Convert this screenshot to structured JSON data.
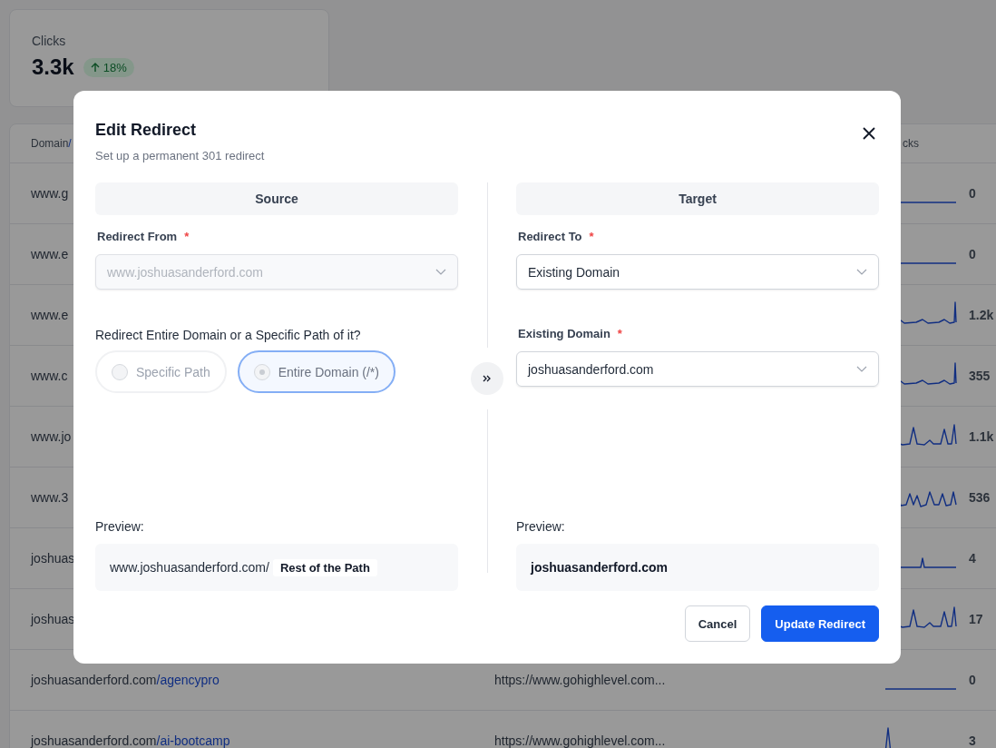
{
  "stats_card": {
    "label": "Clicks",
    "value": "3.3k",
    "change": {
      "text": "18%",
      "kind": "up"
    }
  },
  "table": {
    "columns": [
      {
        "label": "Domain",
        "accent": "/"
      },
      {
        "label": "cks"
      }
    ],
    "rows": [
      {
        "domain": "www.g",
        "clicks": "0",
        "sparkline": {
          "kind": "flat"
        }
      },
      {
        "domain": "www.e",
        "clicks": "0",
        "sparkline": {
          "kind": "flat"
        }
      },
      {
        "domain": "www.e",
        "clicks": "1.2k",
        "sparkline": {
          "kind": "tail"
        }
      },
      {
        "domain": "www.c",
        "clicks": "355",
        "sparkline": {
          "kind": "tail"
        }
      },
      {
        "domain": "www.jo",
        "clicks": "1.1k",
        "sparkline": {
          "kind": "peaks"
        }
      },
      {
        "domain": "www.3",
        "clicks": "536",
        "sparkline": {
          "kind": "waves"
        }
      },
      {
        "domain": "joshuas",
        "clicks": "4",
        "sparkline": {
          "kind": "spike"
        }
      },
      {
        "domain": "joshuas",
        "clicks": "17",
        "sparkline": {
          "kind": "peaks"
        }
      },
      {
        "domain": "joshuasanderford.com",
        "path": "/agencypro",
        "target": "https://www.gohighlevel.com...",
        "clicks": "0",
        "sparkline": {
          "kind": "flat"
        }
      },
      {
        "domain": "joshuasanderford.com",
        "path": "/ai-bootcamp",
        "target": "https://www.gohighlevel.com...",
        "clicks": "3",
        "sparkline": {
          "kind": "first"
        }
      }
    ]
  },
  "dialog": {
    "title": "Edit Redirect",
    "subtitle": "Set up a permanent 301 redirect",
    "source": {
      "heading": "Source",
      "from": {
        "label": "Redirect From",
        "required_mark": "*",
        "value": "www.joshuasanderford.com",
        "disabled": true
      },
      "scope_question": "Redirect Entire Domain or a Specific Path of it?",
      "scope_options": [
        {
          "label": "Specific Path",
          "selected": false
        },
        {
          "label": "Entire Domain (/*)",
          "selected": true
        }
      ],
      "preview_label": "Preview:",
      "preview_text": "www.joshuasanderford.com/",
      "preview_chip": "Rest of the Path"
    },
    "target": {
      "heading": "Target",
      "to": {
        "label": "Redirect To",
        "required_mark": "*",
        "value": "Existing Domain",
        "disabled": false
      },
      "domain": {
        "label": "Existing Domain",
        "required_mark": "*",
        "value": "joshuasanderford.com",
        "disabled": false
      },
      "preview_label": "Preview:",
      "preview_text": "joshuasanderford.com"
    },
    "buttons": [
      {
        "label": "Cancel",
        "kind": "secondary"
      },
      {
        "label": "Update Redirect",
        "kind": "primary"
      }
    ]
  }
}
